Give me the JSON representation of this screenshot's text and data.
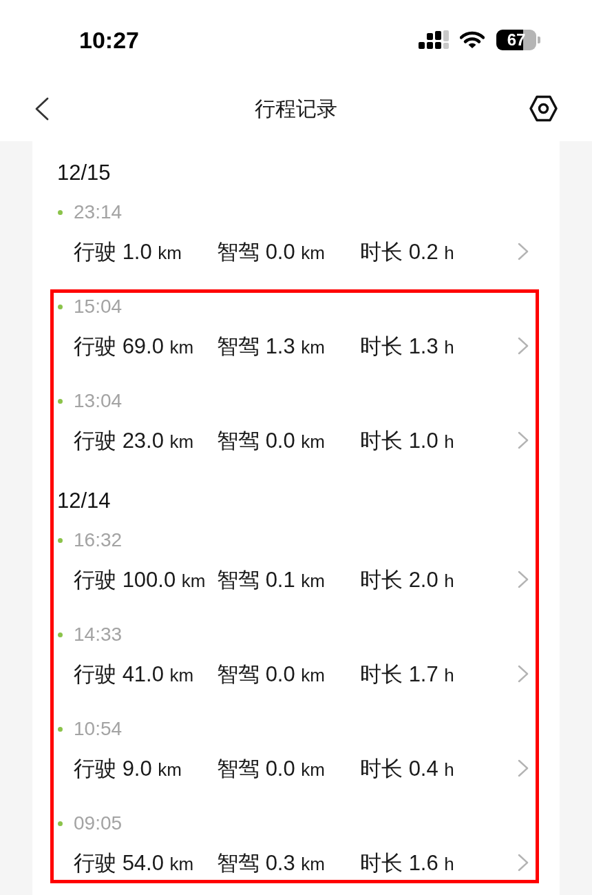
{
  "status_bar": {
    "time": "10:27",
    "battery": "67"
  },
  "header": {
    "title": "行程记录"
  },
  "groups": [
    {
      "framed": false,
      "records": [
        {
          "kind": "date",
          "text": "12/15"
        },
        {
          "kind": "trip",
          "time": "23:14",
          "stats": [
            {
              "label": "行驶",
              "value": "1.0",
              "unit": "km"
            },
            {
              "label": "智驾",
              "value": "0.0",
              "unit": "km"
            },
            {
              "label": "时长",
              "value": "0.2",
              "unit": "h"
            }
          ]
        }
      ]
    },
    {
      "framed": true,
      "records": [
        {
          "kind": "trip",
          "time": "15:04",
          "stats": [
            {
              "label": "行驶",
              "value": "69.0",
              "unit": "km"
            },
            {
              "label": "智驾",
              "value": "1.3",
              "unit": "km"
            },
            {
              "label": "时长",
              "value": "1.3",
              "unit": "h"
            }
          ]
        },
        {
          "kind": "trip",
          "time": "13:04",
          "stats": [
            {
              "label": "行驶",
              "value": "23.0",
              "unit": "km"
            },
            {
              "label": "智驾",
              "value": "0.0",
              "unit": "km"
            },
            {
              "label": "时长",
              "value": "1.0",
              "unit": "h"
            }
          ]
        },
        {
          "kind": "date",
          "text": "12/14"
        },
        {
          "kind": "trip",
          "time": "16:32",
          "stats": [
            {
              "label": "行驶",
              "value": "100.0",
              "unit": "km"
            },
            {
              "label": "智驾",
              "value": "0.1",
              "unit": "km"
            },
            {
              "label": "时长",
              "value": "2.0",
              "unit": "h"
            }
          ]
        },
        {
          "kind": "trip",
          "time": "14:33",
          "stats": [
            {
              "label": "行驶",
              "value": "41.0",
              "unit": "km"
            },
            {
              "label": "智驾",
              "value": "0.0",
              "unit": "km"
            },
            {
              "label": "时长",
              "value": "1.7",
              "unit": "h"
            }
          ]
        },
        {
          "kind": "trip",
          "time": "10:54",
          "stats": [
            {
              "label": "行驶",
              "value": "9.0",
              "unit": "km"
            },
            {
              "label": "智驾",
              "value": "0.0",
              "unit": "km"
            },
            {
              "label": "时长",
              "value": "0.4",
              "unit": "h"
            }
          ]
        },
        {
          "kind": "trip",
          "time": "09:05",
          "stats": [
            {
              "label": "行驶",
              "value": "54.0",
              "unit": "km"
            },
            {
              "label": "智驾",
              "value": "0.3",
              "unit": "km"
            },
            {
              "label": "时长",
              "value": "1.6",
              "unit": "h"
            }
          ]
        }
      ]
    }
  ]
}
